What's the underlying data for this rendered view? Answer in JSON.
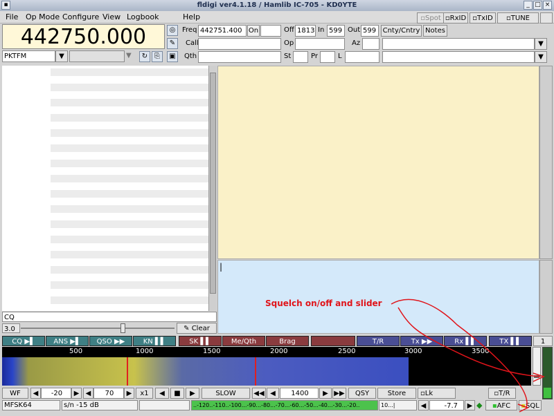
{
  "window": {
    "title": "fldigi ver4.1.18 / Hamlib IC-705 - KD0YTE"
  },
  "menu": [
    "File",
    "Op Mode",
    "Configure",
    "View",
    "Logbook",
    "Help"
  ],
  "toggles": {
    "spot": "Spot",
    "rxid": "RxID",
    "txid": "TxID",
    "tune": "TUNE"
  },
  "freq": {
    "display": "442750.000",
    "label": "Freq",
    "value": "442751.400",
    "on_label": "On",
    "on_value": "",
    "off_label": "Off",
    "off_value": "1813",
    "in_label": "In",
    "in_value": "599",
    "out_label": "Out",
    "out_value": "599",
    "cnty_button": "Cnty/Cntry",
    "notes_button": "Notes"
  },
  "call": {
    "label": "Call",
    "value": "",
    "op_label": "Op",
    "op_value": "",
    "az_label": "Az",
    "az_value": ""
  },
  "qth": {
    "label": "Qth",
    "value": "",
    "st_label": "St",
    "st_value": "",
    "pr_label": "Pr",
    "pr_value": "",
    "l_label": "L",
    "l_value": ""
  },
  "mode_select": {
    "value": "PKTFM"
  },
  "left": {
    "search_value": "CQ",
    "squelch_value": "3.0",
    "clear_button": "Clear"
  },
  "macros": [
    {
      "label": "CQ ▶▌",
      "style": "m1"
    },
    {
      "label": "ANS ▶▌",
      "style": "m1"
    },
    {
      "label": "QSO ▶▶",
      "style": "m1"
    },
    {
      "label": "KN ▌▌",
      "style": "m1"
    },
    {
      "label": "SK ▌▌",
      "style": "m2"
    },
    {
      "label": "Me/Qth",
      "style": "m2"
    },
    {
      "label": "Brag",
      "style": "m2"
    },
    {
      "label": "",
      "style": "m2"
    },
    {
      "label": "T/R",
      "style": "m3"
    },
    {
      "label": "Tx ▶▶",
      "style": "m3"
    },
    {
      "label": "Rx ▌▌",
      "style": "m3"
    },
    {
      "label": "TX ▌▌",
      "style": "m3"
    }
  ],
  "macro_page": "1",
  "scale": [
    "500",
    "1000",
    "1500",
    "2000",
    "2500",
    "3000",
    "3500"
  ],
  "bottom": {
    "wf": "WF",
    "ref_level": "-20",
    "range": "70",
    "x1": "x1",
    "slow": "SLOW",
    "freq_value": "1400",
    "qsy": "QSY",
    "store": "Store",
    "lk": "Lk",
    "tr": "T/R"
  },
  "status": {
    "mode": "MFSK64",
    "sn": "s/n -15 dB",
    "meter_scale": "..-120..-110..-100...-90...-80...-70...-60...-50...-40...-30...-20..",
    "meter_small": "10...|",
    "offset": "-7.7",
    "afc": "AFC",
    "sql": "SQL"
  },
  "annotation": "Squelch on/off and slider",
  "colors": {
    "rx_bg": "#faf1c8",
    "tx_bg": "#d4e9fa",
    "annotation": "#e0141a"
  }
}
